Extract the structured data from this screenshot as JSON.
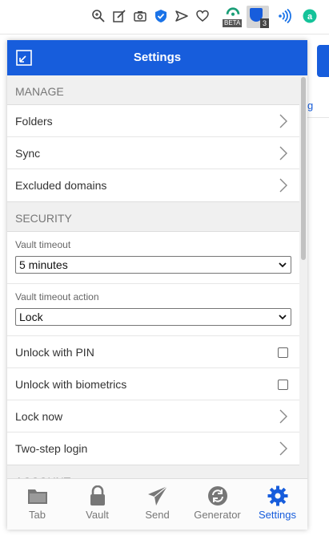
{
  "header": {
    "title": "Settings"
  },
  "toolbar": {
    "ext_badge": "3",
    "beta_label": "BETA"
  },
  "background": {
    "link_fragment": "g"
  },
  "manage": {
    "heading": "MANAGE",
    "items": [
      {
        "label": "Folders"
      },
      {
        "label": "Sync"
      },
      {
        "label": "Excluded domains"
      }
    ]
  },
  "security": {
    "heading": "SECURITY",
    "vault_timeout": {
      "label": "Vault timeout",
      "value": "5 minutes"
    },
    "timeout_action": {
      "label": "Vault timeout action",
      "value": "Lock"
    },
    "unlock_pin": {
      "label": "Unlock with PIN",
      "checked": false
    },
    "unlock_bio": {
      "label": "Unlock with biometrics",
      "checked": false
    },
    "lock_now": {
      "label": "Lock now"
    },
    "two_step": {
      "label": "Two-step login"
    }
  },
  "account": {
    "heading": "ACCOUNT"
  },
  "tabs": [
    {
      "label": "Tab",
      "icon": "folder-icon"
    },
    {
      "label": "Vault",
      "icon": "lock-icon"
    },
    {
      "label": "Send",
      "icon": "paper-plane-icon"
    },
    {
      "label": "Generator",
      "icon": "refresh-icon"
    },
    {
      "label": "Settings",
      "icon": "gear-icon",
      "active": true
    }
  ],
  "colors": {
    "accent": "#175ddc",
    "muted": "#777777"
  }
}
